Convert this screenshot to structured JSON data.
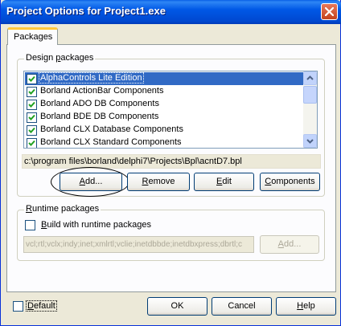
{
  "window": {
    "title": "Project Options for Project1.exe",
    "close_icon": "close-icon"
  },
  "tabs": [
    {
      "label": "Packages",
      "selected": true
    }
  ],
  "design_packages": {
    "group_label": "Design packages",
    "items": [
      {
        "label": "AlphaControls Lite Edition",
        "checked": true,
        "selected": true
      },
      {
        "label": "Borland ActionBar Components",
        "checked": true,
        "selected": false
      },
      {
        "label": "Borland ADO DB Components",
        "checked": true,
        "selected": false
      },
      {
        "label": "Borland BDE DB Components",
        "checked": true,
        "selected": false
      },
      {
        "label": "Borland CLX Database Components",
        "checked": true,
        "selected": false
      },
      {
        "label": "Borland CLX Standard Components",
        "checked": true,
        "selected": false
      }
    ],
    "path": "c:\\program files\\borland\\delphi7\\Projects\\Bpl\\acntD7.bpl",
    "buttons": {
      "add": "Add...",
      "remove": "Remove",
      "edit": "Edit",
      "components": "Components"
    }
  },
  "runtime_packages": {
    "group_label": "Runtime packages",
    "build_with_runtime_label": "Build with runtime packages",
    "build_with_runtime_checked": false,
    "packages_value": "vcl;rtl;vclx;indy;inet;xmlrtl;vclie;inetdbbde;inetdbxpress;dbrtl;c",
    "add_label": "Add..."
  },
  "footer": {
    "default_label": "Default",
    "default_checked": false,
    "ok_label": "OK",
    "cancel_label": "Cancel",
    "help_label": "Help"
  },
  "colors": {
    "titlebar": "#0058e6",
    "selection": "#316ac5",
    "tab_accent": "#ffc83c"
  }
}
